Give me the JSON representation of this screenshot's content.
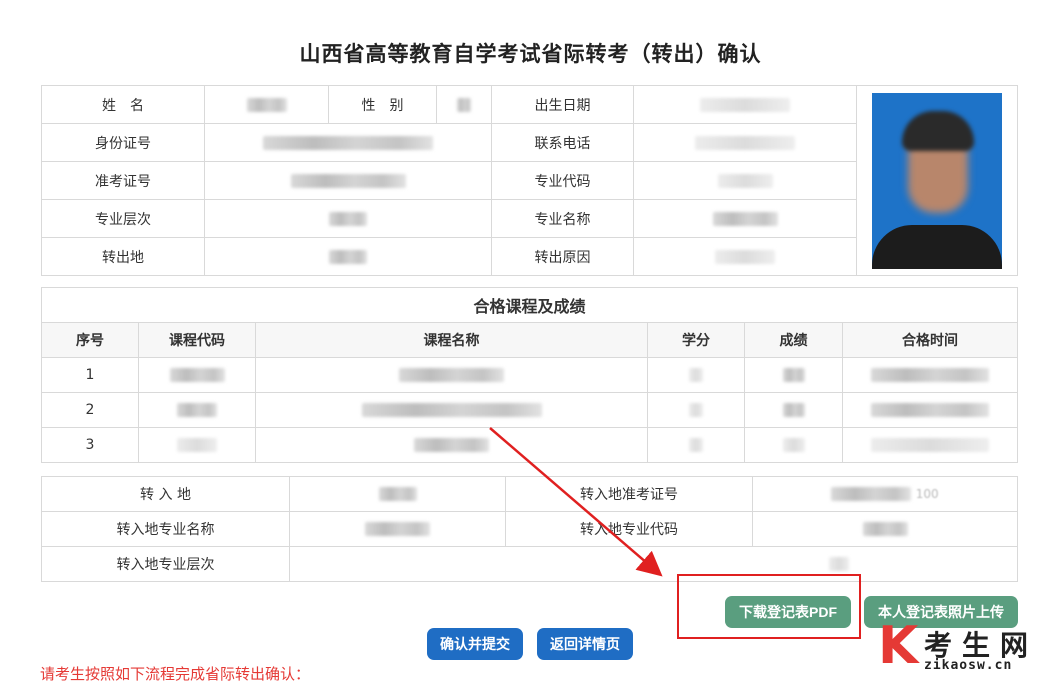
{
  "title": "山西省高等教育自学考试省际转考（转出）确认",
  "info": {
    "name_label": "姓　名",
    "gender_label": "性　别",
    "birth_label": "出生日期",
    "id_label": "身份证号",
    "phone_label": "联系电话",
    "exam_no_label": "准考证号",
    "major_code_label": "专业代码",
    "level_label": "专业层次",
    "major_name_label": "专业名称",
    "out_place_label": "转出地",
    "out_reason_label": "转出原因"
  },
  "courses": {
    "caption": "合格课程及成绩",
    "headers": [
      "序号",
      "课程代码",
      "课程名称",
      "学分",
      "成绩",
      "合格时间"
    ],
    "rows": [
      {
        "no": "1"
      },
      {
        "no": "2"
      },
      {
        "no": "3"
      }
    ]
  },
  "transfer": {
    "in_place_label": "转 入 地",
    "in_exam_no_label": "转入地准考证号",
    "in_exam_no_tail": "100",
    "in_major_name_label": "转入地专业名称",
    "in_major_code_label": "转入地专业代码",
    "in_level_label": "转入地专业层次"
  },
  "buttons": {
    "download_pdf": "下载登记表PDF",
    "upload_photo": "本人登记表照片上传",
    "confirm_submit": "确认并提交",
    "back_detail": "返回详情页"
  },
  "notice": "请考生按照如下流程完成省际转出确认：",
  "watermark": {
    "k": "K",
    "name": "考生网",
    "url": "zikaosw.cn"
  },
  "colors": {
    "green_button": "#5a9e7f",
    "blue_button": "#1f6dc4",
    "notice_red": "#e53935",
    "highlight_red": "#e02020"
  }
}
